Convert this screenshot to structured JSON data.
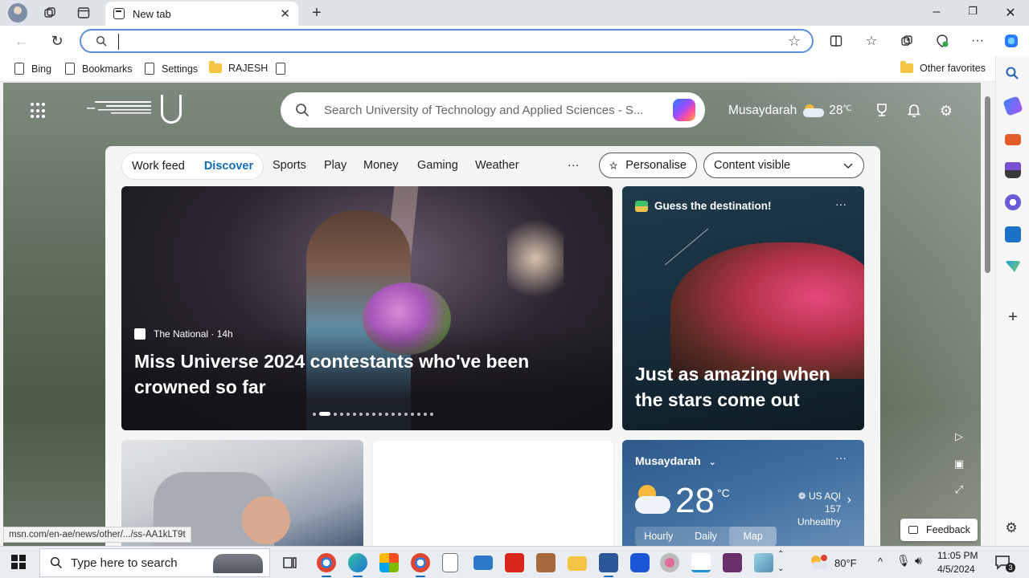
{
  "browser": {
    "tab_title": "New tab",
    "address_value": "",
    "favorites": [
      {
        "label": "Bing",
        "kind": "page"
      },
      {
        "label": "Bookmarks",
        "kind": "page"
      },
      {
        "label": "Settings",
        "kind": "page"
      },
      {
        "label": "RAJESH",
        "kind": "folder"
      }
    ],
    "other_favorites": "Other favorites",
    "status_url": "msn.com/en-ae/news/other/.../ss-AA1kLT9t"
  },
  "msn": {
    "search_placeholder": "Search University of Technology and Applied Sciences - S...",
    "location": "Musaydarah",
    "header_temp": "28",
    "header_temp_unit": "℃",
    "feed_tabs": {
      "work_feed": "Work feed",
      "discover": "Discover"
    },
    "nav": [
      "Sports",
      "Play",
      "Money",
      "Gaming",
      "Weather"
    ],
    "more_label": "···",
    "personalise": "Personalise",
    "content_visible": "Content visible",
    "hero": {
      "source": "The National · 14h",
      "headline": "Miss Universe 2024 contestants who've been crowned so far",
      "slide_count": 18,
      "active_slide": 1
    },
    "destination": {
      "header": "Guess the destination!",
      "title": "Just as amazing when the stars come out"
    },
    "weather": {
      "location": "Musaydarah",
      "temp": "28",
      "unit": "°C",
      "aqi": "US AQI 157",
      "aqi_status": "Unhealthy",
      "tabs": [
        "Hourly",
        "Daily",
        "Map"
      ],
      "selected_tab": "Map"
    },
    "feedback": "Feedback"
  },
  "taskbar": {
    "search_placeholder": "Type here to search",
    "weather_temp": "80°F",
    "time": "11:05 PM",
    "date": "4/5/2024",
    "notifications": "3"
  },
  "colors": {
    "accent": "#0f6cbd",
    "omnibox_border": "#5b8fd6"
  }
}
